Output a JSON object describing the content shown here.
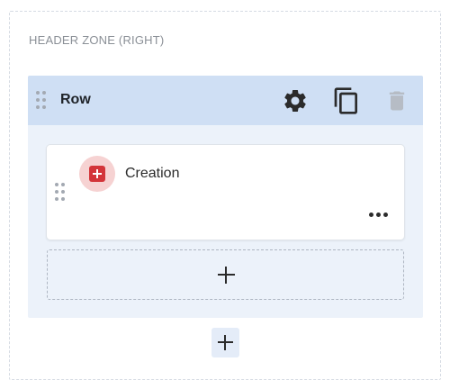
{
  "zone": {
    "label": "HEADER ZONE (RIGHT)"
  },
  "row": {
    "title": "Row",
    "actions": [
      {
        "name": "settings",
        "icon": "gear-icon"
      },
      {
        "name": "duplicate",
        "icon": "copy-icon"
      },
      {
        "name": "delete",
        "icon": "trash-icon",
        "state": "disabled"
      }
    ]
  },
  "card": {
    "title": "Creation",
    "icon": "plus-square-icon",
    "icon_color": "#d3353a",
    "more_icon": "more-horizontal-icon"
  },
  "add_component": {
    "icon": "plus-icon"
  },
  "add_row": {
    "icon": "plus-icon"
  },
  "colors": {
    "row_header_bg": "#cfdff4",
    "row_body_bg": "#ecf2fa",
    "icon_badge_bg": "#f6d2d2",
    "disabled_icon": "#b6bcc5"
  }
}
